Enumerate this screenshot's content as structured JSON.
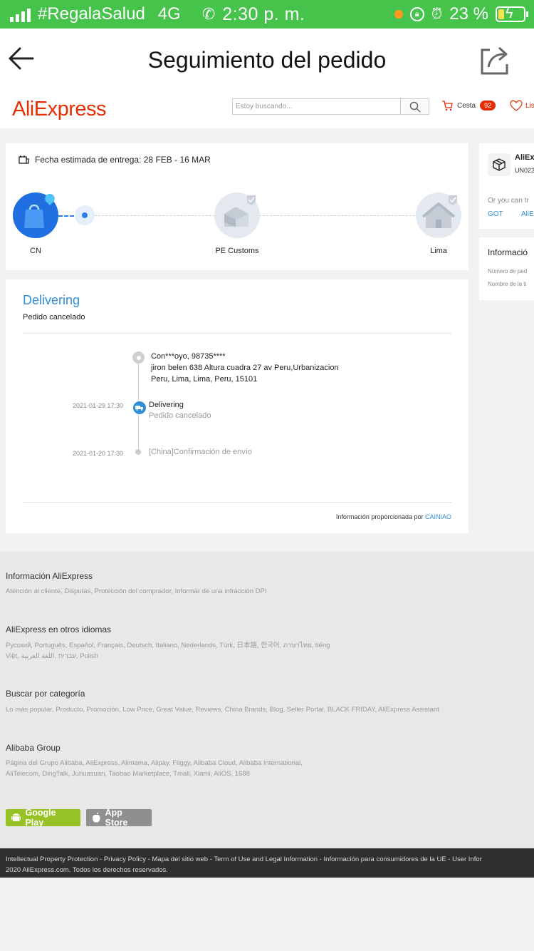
{
  "status_bar": {
    "carrier": "#RegalaSalud",
    "network": "4G",
    "time": "2:30 p. m.",
    "battery": "23 %",
    "battery_level": 0.23
  },
  "app_header": {
    "title": "Seguimiento del pedido"
  },
  "site_header": {
    "logo": "AliExpress",
    "search_placeholder": "Estoy buscando...",
    "cart_label": "Cesta",
    "cart_count": "92",
    "wishlist_label": "Lis"
  },
  "delivery": {
    "estimate": "Fecha estimada de entrega: 28 FEB - 16 MAR",
    "nodes": [
      {
        "label": "CN"
      },
      {
        "label": "PE Customs"
      },
      {
        "label": "Lima"
      }
    ]
  },
  "status": {
    "title": "Delivering",
    "subtitle": "Pedido cancelado",
    "address": {
      "line1": "Con***oyo,  98735****",
      "line2": "jiron belen 638 Altura cuadra 27 av Peru,Urbanizacion",
      "line3": "Peru,  Lima,  Lima,  Peru,  15101"
    },
    "events": [
      {
        "date": "2021-01-29 17:30",
        "title": "Delivering",
        "desc": "Pedido cancelado"
      },
      {
        "date": "2021-01-20 17:30",
        "desc": "[China]Confirmación de envío"
      }
    ],
    "provided_by": "Información proporcionada por ",
    "provider": "CAINIAO"
  },
  "side_panel": {
    "carrier_name": "AliEx",
    "tracking_code": "UN023",
    "note": "Or you can tr",
    "link1": "GOT",
    "link2": "AliE",
    "info_title": "Informació",
    "field1": "Número de ped",
    "field2": "Nombre de la ti"
  },
  "footer": {
    "sections": [
      {
        "title": "Información AliExpress",
        "text": "Atención al cliente, Disputas, Protección del comprador, Informar de una infracción DPI"
      },
      {
        "title": "AliExpress en otros idiomas",
        "text": "Русский, Português, Español, Français, Deutsch, Italiano, Nederlands, Türk, 日本語, 한국어, ภาษาไทย, tiếng Việt, עברית ,اللغة العربية, Polish"
      },
      {
        "title": "Buscar por categoría",
        "text": "Lo más popular, Producto, Promoción, Low Price, Great Value, Reviews, China Brands, Blog, Seller Portal, BLACK FRIDAY, AliExpress Assistant"
      },
      {
        "title": "Alibaba Group",
        "text": "Página del Grupo Alibaba, AliExpress, Alimama, Alipay, Fliggy, Alibaba Cloud, Alibaba International, AliTelecom, DingTalk, Juhuasuan, Taobao Marketplace, Tmall, Xiami, AliOS, 1688"
      }
    ],
    "google_play": "Google Play",
    "app_store": "App Store",
    "legal_links": "Intellectual Property Protection  -  Privacy Policy  -  Mapa del sitio web  -  Term of Use and Legal Information  -  Información para consumidores de la UE  -  User Infor",
    "copyright": "2020 AliExpress.com. Todos los derechos reservados."
  }
}
